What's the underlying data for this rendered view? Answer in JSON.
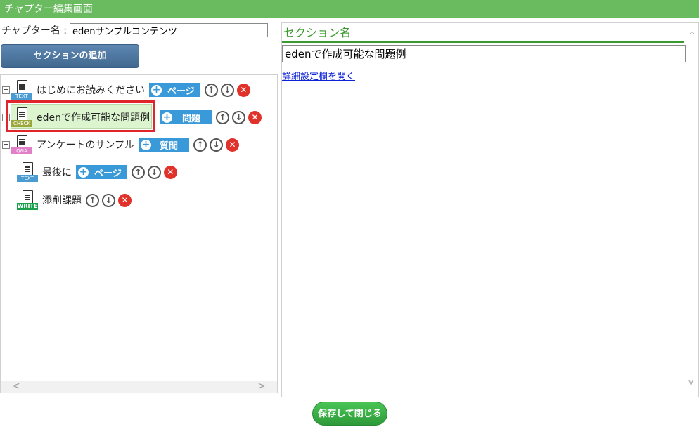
{
  "window": {
    "title": "チャプター編集画面"
  },
  "chapter": {
    "label": "チャプター名 :",
    "value": "edenサンプルコンテンツ"
  },
  "toolbar": {
    "add_section_label": "セクションの追加"
  },
  "tree": {
    "items": [
      {
        "label": "はじめにお読みください",
        "icon": "text-doc-icon",
        "icon_tag": "TEXT",
        "add_label": "ページ",
        "expandable": true,
        "selected": false
      },
      {
        "label": "edenで作成可能な問題例",
        "icon": "check-doc-icon",
        "icon_tag": "CHECK",
        "add_label": "問題",
        "expandable": true,
        "selected": true
      },
      {
        "label": "アンケートのサンプル",
        "icon": "qa-doc-icon",
        "icon_tag": "Q&A",
        "add_label": "質問",
        "expandable": true,
        "selected": false
      },
      {
        "label": "最後に",
        "icon": "text-doc-icon",
        "icon_tag": "TEXT",
        "add_label": "ページ",
        "expandable": false,
        "selected": false
      },
      {
        "label": "添削課題",
        "icon": "write-doc-icon",
        "icon_tag": "WRITE",
        "add_label": "",
        "expandable": false,
        "selected": false
      }
    ],
    "expand_glyph": "+",
    "up_glyph": "↑",
    "down_glyph": "↓",
    "delete_glyph": "✕",
    "plus_glyph": "+",
    "scroll_left": "<",
    "scroll_right": ">"
  },
  "section": {
    "heading": "セクション名",
    "name_value": "edenで作成可能な問題例",
    "details_link": "詳細設定欄を開く",
    "scroll_up": "^",
    "scroll_down": "v"
  },
  "footer": {
    "save_close_label": "保存して閉じる"
  },
  "colors": {
    "titlebar": "#6abb5f",
    "add_button": "#3a9ad9",
    "delete": "#e0322b",
    "selected_outline": "#e0262a",
    "heading_green": "#3a9a2e",
    "link": "#0b22d6"
  }
}
